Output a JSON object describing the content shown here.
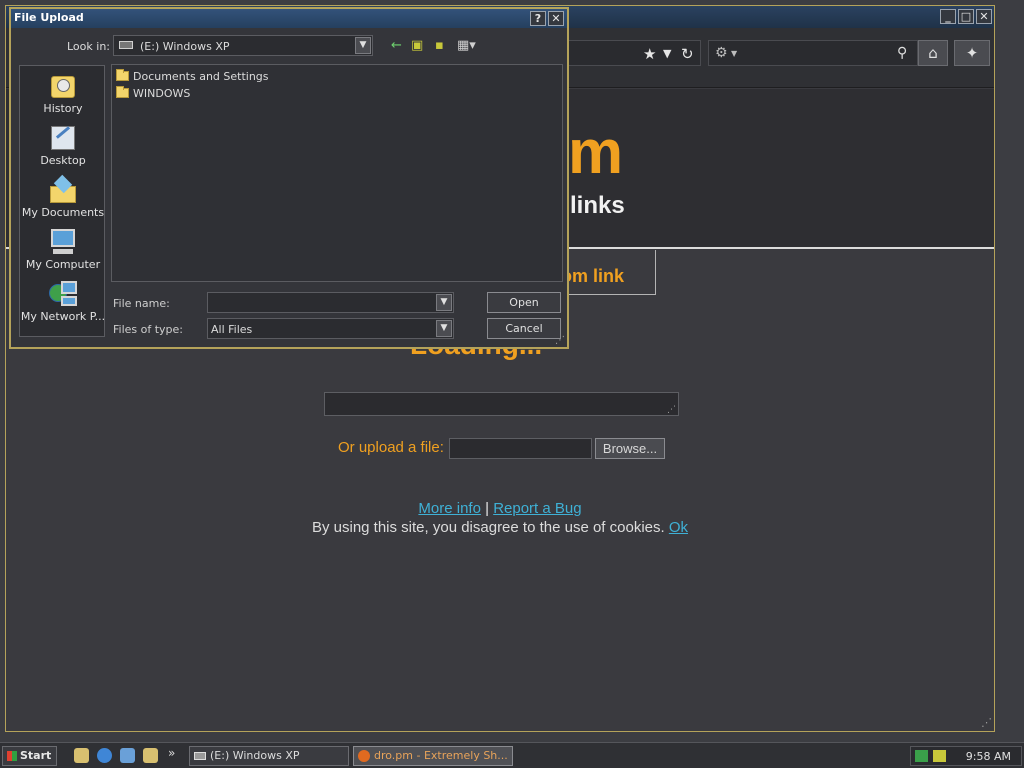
{
  "dialog": {
    "title": "File Upload",
    "help_btn": "?",
    "close_btn": "✕",
    "lookin_label": "Look in:",
    "lookin_value": "(E:) Windows XP",
    "places": [
      {
        "label": "History",
        "icon": "history-icon"
      },
      {
        "label": "Desktop",
        "icon": "desktop-icon"
      },
      {
        "label": "My Documents",
        "icon": "my-documents-icon"
      },
      {
        "label": "My Computer",
        "icon": "my-computer-icon"
      },
      {
        "label": "My Network P...",
        "icon": "network-places-icon"
      }
    ],
    "files": [
      "Documents and Settings",
      "WINDOWS"
    ],
    "filename_label": "File name:",
    "filename_value": "",
    "filetype_label": "Files of type:",
    "filetype_value": "All Files",
    "open_label": "Open",
    "cancel_label": "Cancel"
  },
  "browser": {
    "min_btn": "_",
    "max_btn": "□",
    "close_btn": "✕",
    "brand_fragment": "m",
    "tagline_fragment": "links",
    "tab_label_fragment": "om link",
    "loading_text": "Loading...",
    "upload_label": "Or upload a file:",
    "browse_label": "Browse...",
    "more_info": "More info",
    "separator": "|",
    "report_bug": "Report a Bug",
    "cookie_text": "By using this site, you disagree to the use of cookies.",
    "cookie_ok": "Ok"
  },
  "taskbar": {
    "start_label": "Start",
    "quicklaunch_more": "»",
    "tasks": [
      {
        "label": "(E:) Windows XP",
        "active": false
      },
      {
        "label": "dro.pm - Extremely Sh...",
        "active": true
      }
    ],
    "clock": "9:58 AM"
  },
  "colors": {
    "accent": "#f0a020",
    "link": "#3fb1d6",
    "frame": "#b5a35a"
  }
}
